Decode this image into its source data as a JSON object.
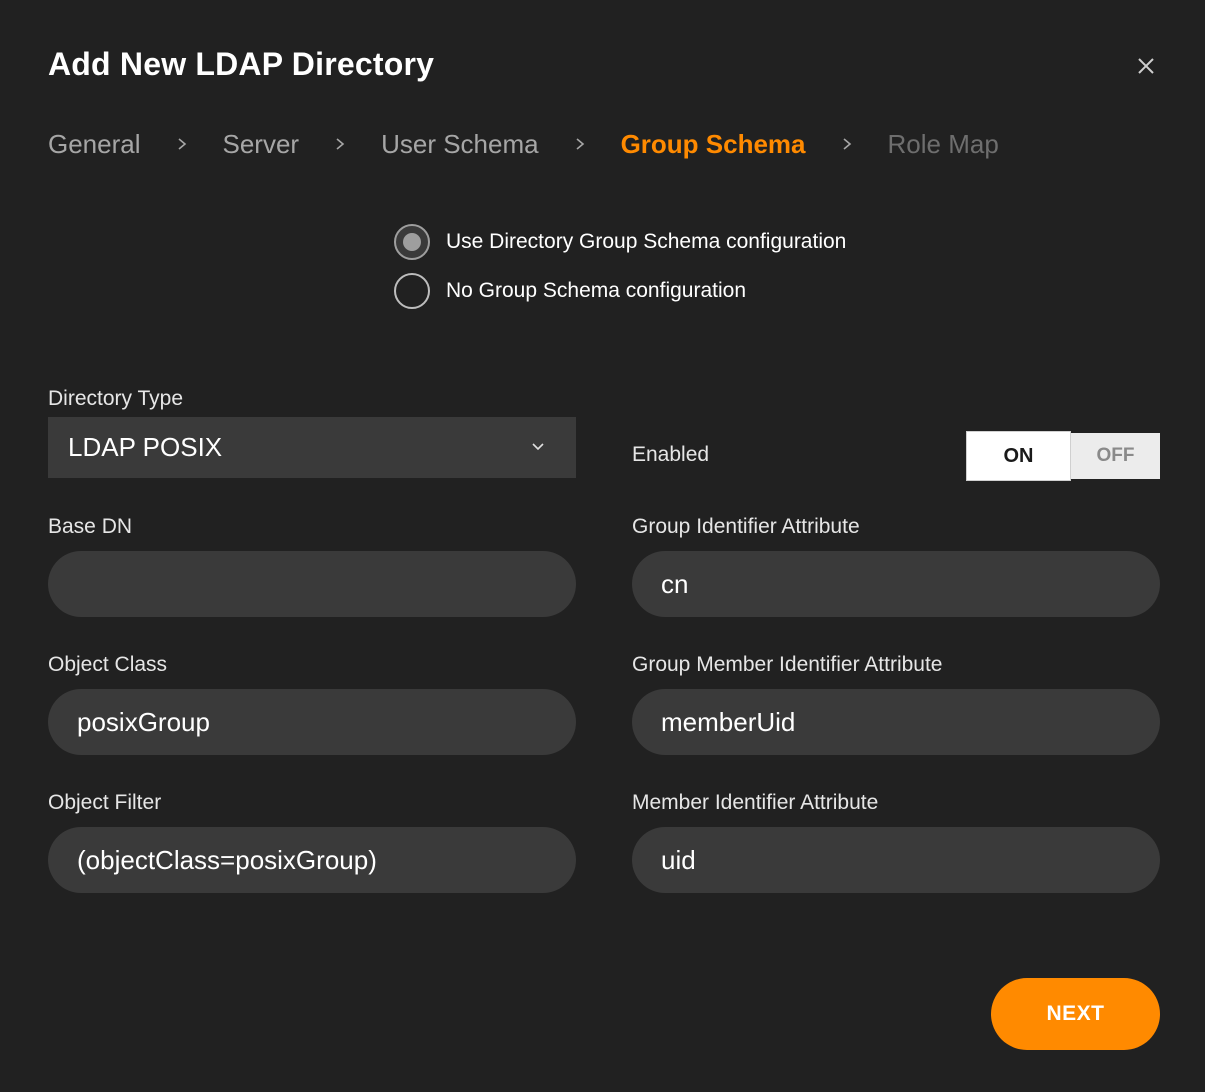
{
  "dialog": {
    "title": "Add New LDAP Directory",
    "close_icon": "close-icon"
  },
  "steps": [
    {
      "label": "General",
      "state": "done"
    },
    {
      "label": "Server",
      "state": "done"
    },
    {
      "label": "User Schema",
      "state": "done"
    },
    {
      "label": "Group Schema",
      "state": "active"
    },
    {
      "label": "Role Map",
      "state": "disabled"
    }
  ],
  "schema_options": {
    "use_directory": {
      "label": "Use Directory Group Schema configuration",
      "checked": true
    },
    "none": {
      "label": "No Group Schema configuration",
      "checked": false
    }
  },
  "directory_type": {
    "label": "Directory Type",
    "value": "LDAP POSIX"
  },
  "enabled": {
    "label": "Enabled",
    "on_label": "ON",
    "off_label": "OFF",
    "state": "ON"
  },
  "base_dn": {
    "label": "Base DN",
    "value": ""
  },
  "group_identifier": {
    "label": "Group Identifier Attribute",
    "value": "cn"
  },
  "object_class": {
    "label": "Object Class",
    "value": "posixGroup"
  },
  "group_member_identifier": {
    "label": "Group Member Identifier Attribute",
    "value": "memberUid"
  },
  "object_filter": {
    "label": "Object Filter",
    "value": "(objectClass=posixGroup)"
  },
  "member_identifier": {
    "label": "Member Identifier Attribute",
    "value": "uid"
  },
  "next_button": {
    "label": "NEXT"
  },
  "colors": {
    "background": "#212121",
    "accent": "#ff8a00",
    "field": "#3a3a3a",
    "muted_text": "#a6a6a6",
    "disabled_text": "#6e6e6e"
  }
}
